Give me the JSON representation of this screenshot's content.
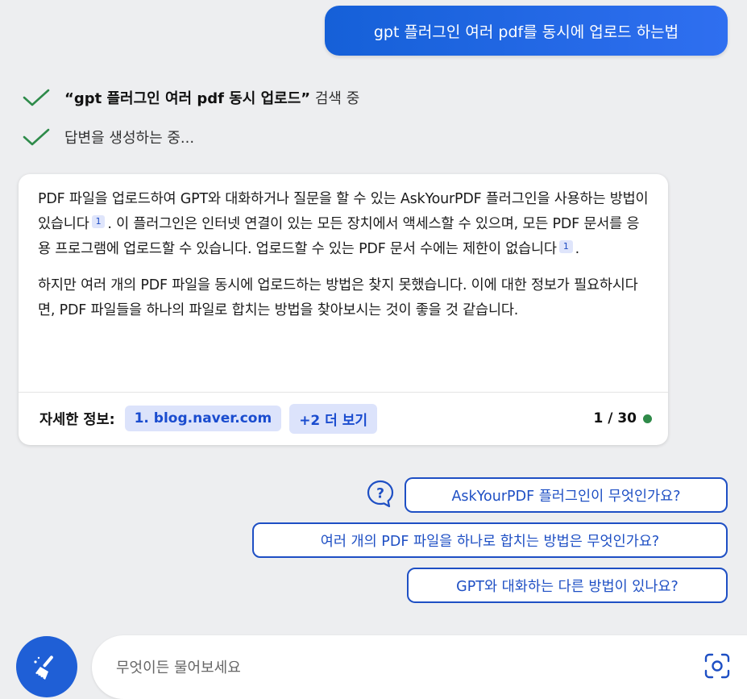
{
  "user_message": "gpt 플러그인 여러 pdf를 동시에 업로드 하는법",
  "status": {
    "search_query": "“gpt 플러그인 여러 pdf 동시 업로드”",
    "search_suffix": " 검색 중",
    "generating": "답변을 생성하는 중..."
  },
  "answer": {
    "p1_a": "PDF 파일을 업로드하여 GPT와 대화하거나 질문을 할 수 있는 AskYourPDF 플러그인을 사용하는 방법이 있습니다",
    "p1_cite1": "1",
    "p1_b": ". 이 플러그인은 인터넷 연결이 있는 모든 장치에서 액세스할 수 있으며, 모든 PDF 문서를 응용 프로그램에 업로드할 수 있습니다. 업로드할 수 있는 PDF 문서 수에는 제한이 없습니다",
    "p1_cite2": "1",
    "p1_c": ".",
    "p2": "하지만 여러 개의 PDF 파일을 동시에 업로드하는 방법은 찾지 못했습니다. 이에 대한 정보가 필요하시다면, PDF 파일들을 하나의 파일로 합치는 방법을 찾아보시는 것이 좋을 것 같습니다."
  },
  "footer": {
    "label": "자세한 정보:",
    "source_link": "1. blog.naver.com",
    "more_link": "+2 더 보기",
    "counter": "1 / 30"
  },
  "suggestions": [
    "AskYourPDF 플러그인이 무엇인가요?",
    "여러 개의 PDF 파일을 하나로 합치는 방법은 무엇인가요?",
    "GPT와 대화하는 다른 방법이 있나요?"
  ],
  "input": {
    "placeholder": "무엇이든 물어보세요"
  },
  "colors": {
    "accent": "#1f5fd6",
    "check": "#2e8b4a",
    "status_dot": "#2f8a49"
  }
}
